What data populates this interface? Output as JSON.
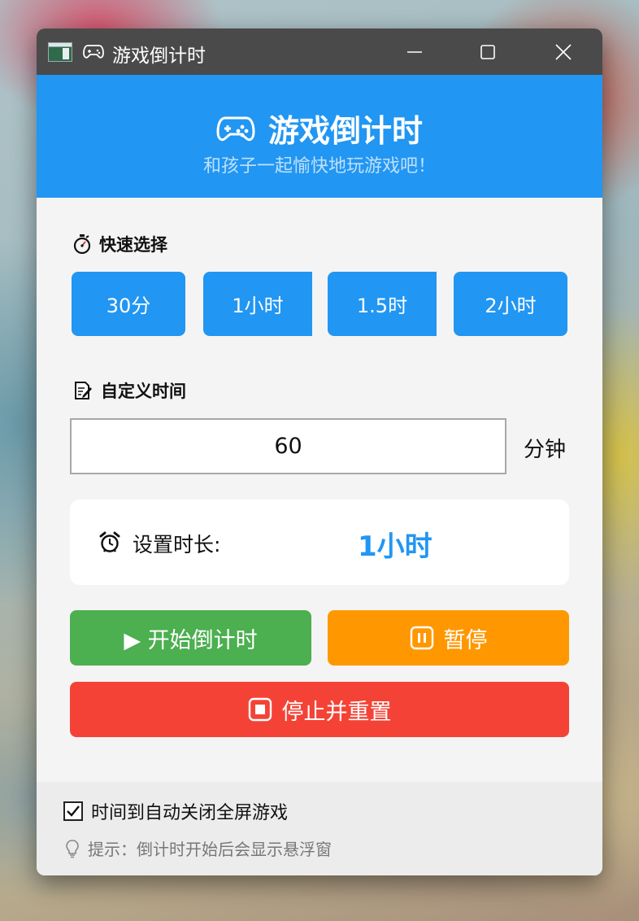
{
  "window": {
    "title": "游戏倒计时"
  },
  "header": {
    "title": "游戏倒计时",
    "subtitle": "和孩子一起愉快地玩游戏吧！"
  },
  "quick": {
    "label": "快速选择",
    "buttons": [
      "30分",
      "1小时",
      "1.5时",
      "2小时"
    ]
  },
  "custom": {
    "label": "自定义时间",
    "value": "60",
    "unit": "分钟"
  },
  "duration": {
    "label": "设置时长:",
    "value": "1小时"
  },
  "actions": {
    "start": "▶ 开始倒计时",
    "pause": "暂停",
    "stop": "停止并重置"
  },
  "footer": {
    "auto_close_label": "时间到自动关闭全屏游戏",
    "auto_close_checked": true,
    "tip": "提示：倒计时开始后会显示悬浮窗"
  },
  "colors": {
    "primary": "#2196f3",
    "start": "#4caf50",
    "pause": "#ff9800",
    "stop": "#f44336",
    "titlebar": "#4a4a4a"
  },
  "icons": {
    "title_icon": "gamepad-icon",
    "quick_icon": "stopwatch-icon",
    "custom_icon": "memo-icon",
    "duration_icon": "alarm-clock-icon",
    "pause_icon": "pause-icon",
    "stop_icon": "stop-icon",
    "tip_icon": "lightbulb-icon"
  }
}
